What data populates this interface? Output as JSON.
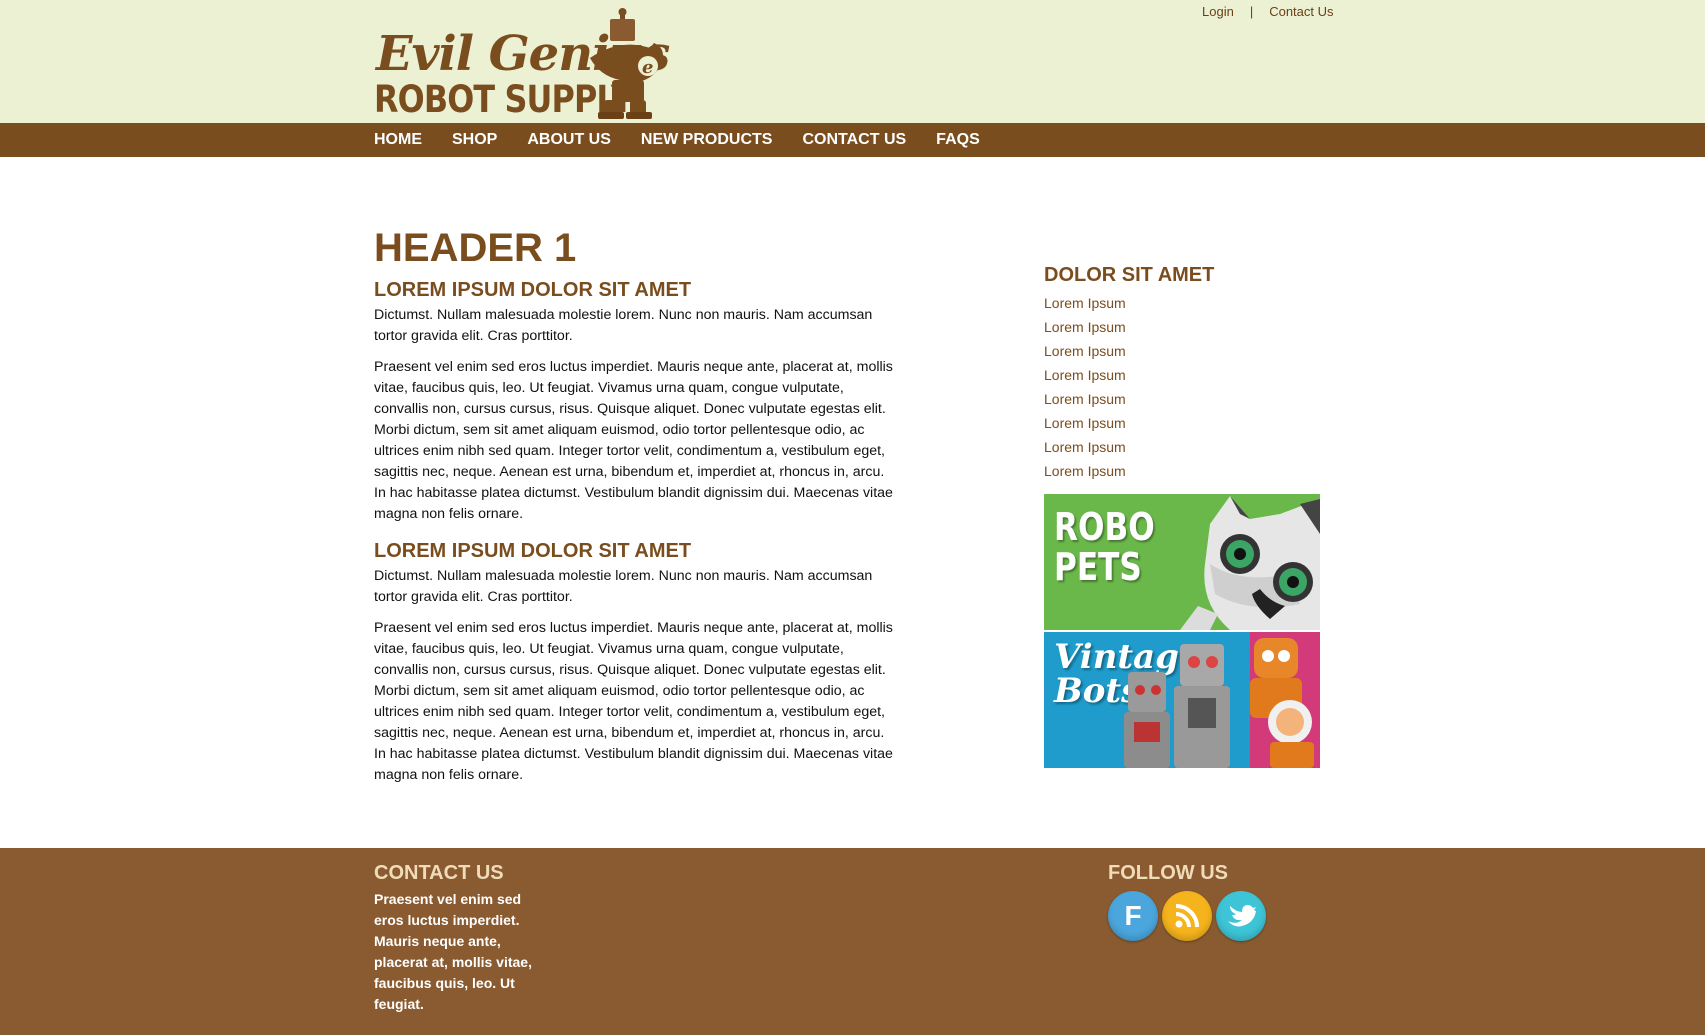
{
  "utility_nav": {
    "login": "Login",
    "separator": "|",
    "contact": "Contact Us"
  },
  "logo": {
    "line1": "Evil Genius",
    "line2": "ROBOT SUPPLY"
  },
  "nav": [
    "HOME",
    "SHOP",
    "ABOUT US",
    "NEW PRODUCTS",
    "CONTACT US",
    "FAQS"
  ],
  "main": {
    "heading": "HEADER 1",
    "sections": [
      {
        "subheading": "LOREM IPSUM DOLOR SIT AMET",
        "intro": "Dictumst. Nullam malesuada molestie lorem. Nunc non mauris. Nam accumsan tortor gravida elit. Cras porttitor.",
        "body": "Praesent vel enim sed eros luctus imperdiet. Mauris neque ante, placerat at, mollis vitae, faucibus quis, leo. Ut feugiat. Vivamus urna quam, congue vulputate, convallis non, cursus cursus, risus. Quisque aliquet. Donec vulputate egestas elit. Morbi dictum, sem sit amet aliquam euismod, odio tortor pellentesque odio, ac ultrices enim nibh sed quam. Integer tortor velit, condimentum a, vestibulum eget, sagittis nec, neque. Aenean est urna, bibendum et, imperdiet at, rhoncus in, arcu. In hac habitasse platea dictumst. Vestibulum blandit dignissim dui. Maecenas vitae magna non felis ornare."
      },
      {
        "subheading": "LOREM IPSUM DOLOR SIT AMET",
        "intro": "Dictumst. Nullam malesuada molestie lorem. Nunc non mauris. Nam accumsan tortor gravida elit. Cras porttitor.",
        "body": "Praesent vel enim sed eros luctus imperdiet. Mauris neque ante, placerat at, mollis vitae, faucibus quis, leo. Ut feugiat. Vivamus urna quam, congue vulputate, convallis non, cursus cursus, risus. Quisque aliquet. Donec vulputate egestas elit. Morbi dictum, sem sit amet aliquam euismod, odio tortor pellentesque odio, ac ultrices enim nibh sed quam. Integer tortor velit, condimentum a, vestibulum eget, sagittis nec, neque. Aenean est urna, bibendum et, imperdiet at, rhoncus in, arcu. In hac habitasse platea dictumst. Vestibulum blandit dignissim dui. Maecenas vitae magna non felis ornare."
      }
    ]
  },
  "sidebar": {
    "heading": "DOLOR SIT AMET",
    "links": [
      "Lorem Ipsum",
      "Lorem Ipsum",
      "Lorem Ipsum",
      "Lorem Ipsum",
      "Lorem Ipsum",
      "Lorem Ipsum",
      "Lorem Ipsum",
      "Lorem Ipsum"
    ],
    "promos": [
      {
        "line1": "ROBO",
        "line2": "PETS"
      },
      {
        "line1": "Vintage",
        "line2": "Bots"
      }
    ]
  },
  "footer": {
    "contact_heading": "CONTACT US",
    "contact_text": "Praesent vel enim sed eros luctus imperdiet. Mauris neque ante, placerat at, mollis vitae, faucibus quis, leo. Ut feugiat.",
    "follow_heading": "FOLLOW US",
    "social": [
      {
        "icon": "facebook-icon",
        "glyph": "F",
        "color": "#4aa6dc"
      },
      {
        "icon": "rss-icon",
        "glyph": "",
        "color": "#f5b31c"
      },
      {
        "icon": "twitter-icon",
        "glyph": "",
        "color": "#3dc4d6"
      }
    ]
  },
  "colors": {
    "brand_brown": "#7a4d1e",
    "header_bg": "#ecf1d4",
    "footer_bg": "#8a5a30",
    "pets_green": "#6bb84a",
    "vintage_blue": "#1f9ccc"
  }
}
